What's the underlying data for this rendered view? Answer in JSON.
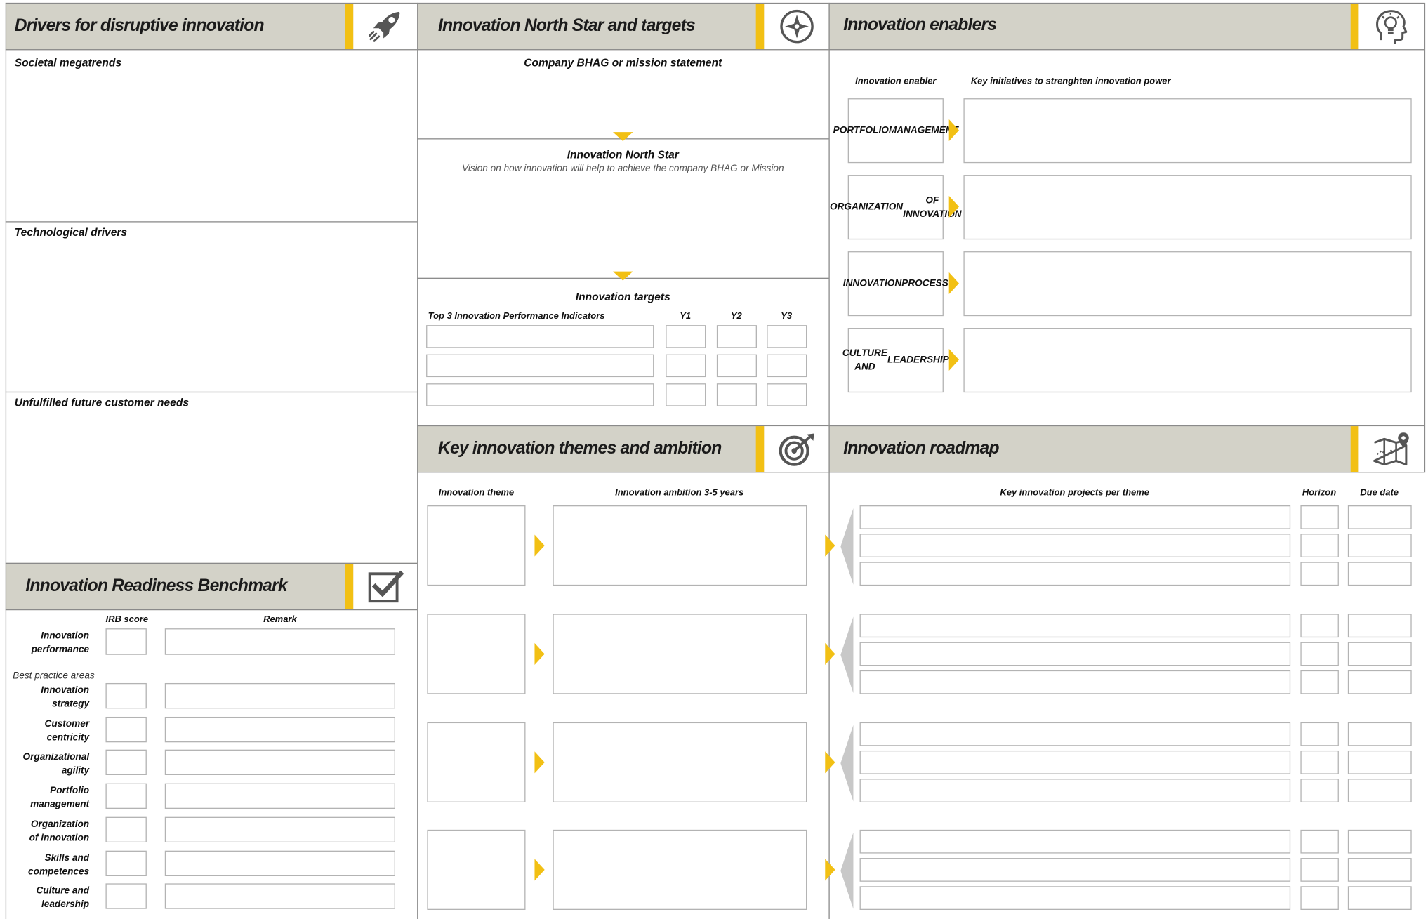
{
  "colors": {
    "accent": "#f2c014",
    "header_bg": "#d3d2c8",
    "divider": "#8a8a8a",
    "field_border": "#b3b3b3",
    "inbound_arrow": "#c8c8c8"
  },
  "drivers": {
    "title": "Drivers for disruptive innovation",
    "icon": "rocket-icon",
    "sections": [
      "Societal megatrends",
      "Technological drivers",
      "Unfulfilled future customer needs"
    ]
  },
  "northstar": {
    "title": "Innovation North Star and  targets",
    "icon": "compass-icon",
    "bhag_label": "Company BHAG or mission statement",
    "northstar_label": "Innovation North Star",
    "northstar_sub": "Vision on how innovation will help to achieve the company BHAG or Mission",
    "targets_label": "Innovation targets",
    "kpi_head": "Top 3 Innovation Performance Indicators",
    "year_heads": [
      "Y1",
      "Y2",
      "Y3"
    ]
  },
  "enablers": {
    "title": "Innovation enablers",
    "icon": "lightbulb-head-icon",
    "col_enabler": "Innovation enabler",
    "col_initiatives": "Key initiatives to strenghten innovation power",
    "items": [
      {
        "line1": "PORTFOLIO",
        "line2": "MANAGEMENT"
      },
      {
        "line1": "ORGANIZATION",
        "line2": "OF INNOVATION"
      },
      {
        "line1": "INNOVATION",
        "line2": "PROCESS"
      },
      {
        "line1": "CULTURE AND",
        "line2": "LEADERSHIP"
      }
    ]
  },
  "irb": {
    "title": "Innovation Readiness Benchmark",
    "icon": "checkbox-icon",
    "col_score": "IRB score",
    "col_remark": "Remark",
    "performance": {
      "line1": "Innovation",
      "line2": "performance"
    },
    "best_practice_label": "Best practice areas",
    "areas": [
      {
        "line1": "Innovation",
        "line2": "strategy"
      },
      {
        "line1": "Customer",
        "line2": "centricity"
      },
      {
        "line1": "Organizational",
        "line2": "agility"
      },
      {
        "line1": "Portfolio",
        "line2": "management"
      },
      {
        "line1": "Organization",
        "line2": "of innovation"
      },
      {
        "line1": "Skills and",
        "line2": "competences"
      },
      {
        "line1": "Culture and",
        "line2": "leadership"
      }
    ]
  },
  "themes": {
    "title": "Key innovation themes and ambition",
    "icon": "target-arrow-icon",
    "col_theme": "Innovation theme",
    "col_ambition": "Innovation ambition 3-5 years"
  },
  "roadmap": {
    "title": "Innovation roadmap",
    "icon": "map-pin-icon",
    "col_projects": "Key innovation projects per theme",
    "col_horizon": "Horizon",
    "col_due": "Due date"
  }
}
